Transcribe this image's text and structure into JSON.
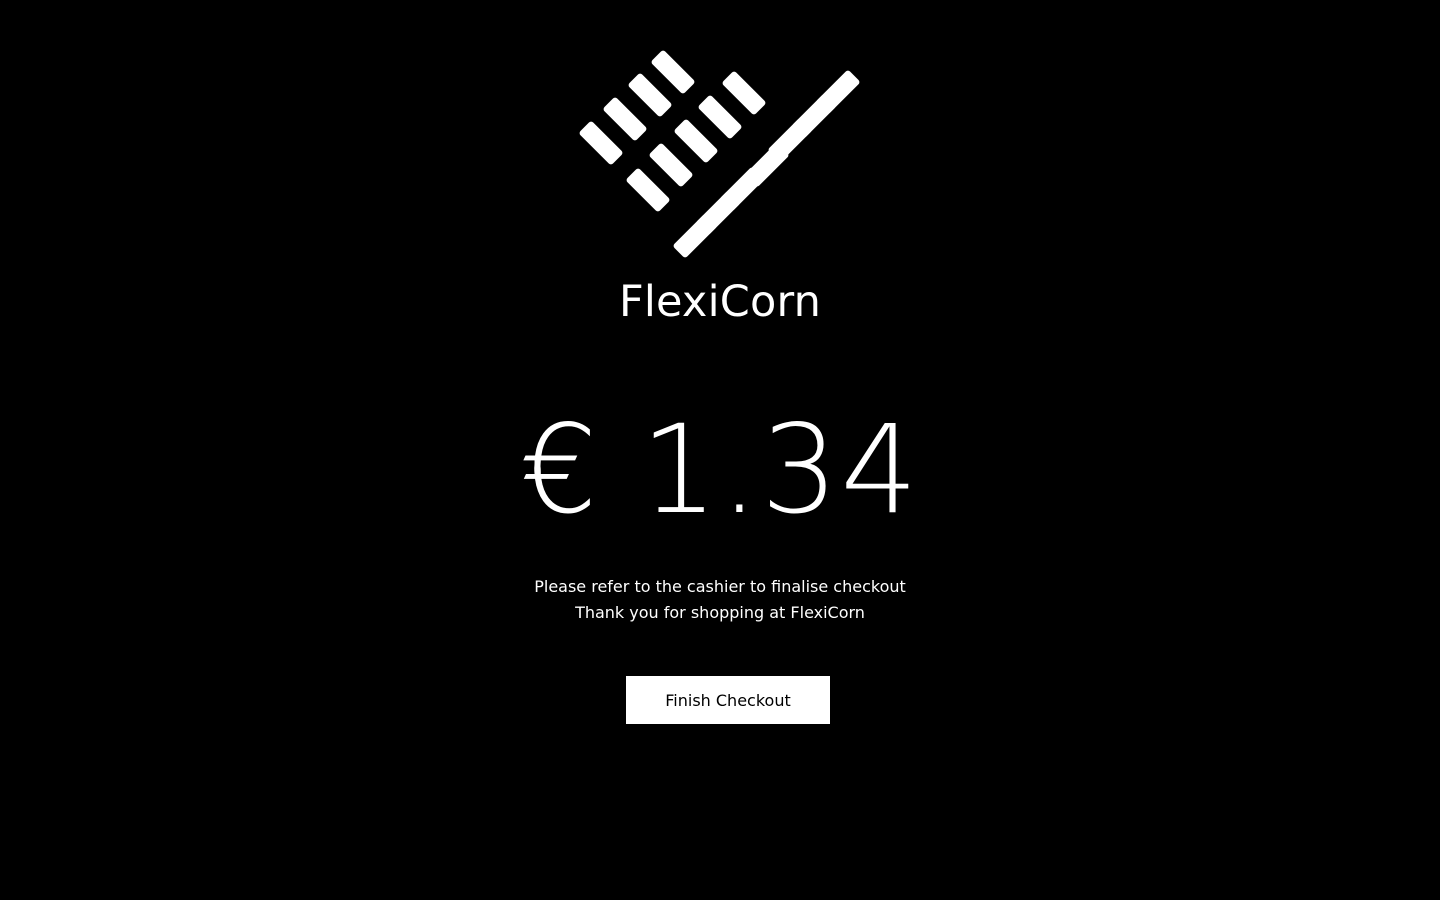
{
  "brand": {
    "logo_icon": "flexicorn-heart-logo-icon",
    "name": "FlexiCorn"
  },
  "payment": {
    "amount": "€ 1.34"
  },
  "messages": {
    "line1": "Please refer to the cashier to finalise checkout",
    "line2": "Thank you for shopping at FlexiCorn"
  },
  "actions": {
    "finish_label": "Finish Checkout"
  },
  "colors": {
    "background": "#000000",
    "foreground": "#ffffff"
  }
}
